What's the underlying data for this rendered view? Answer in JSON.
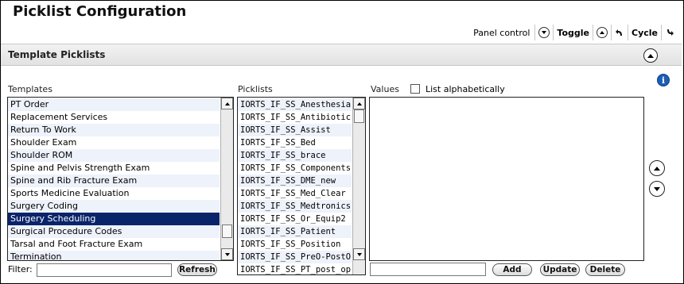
{
  "page": {
    "title": "Picklist Configuration"
  },
  "panel_control": {
    "label": "Panel control",
    "toggle_label": "Toggle",
    "cycle_label": "Cycle"
  },
  "section": {
    "title": "Template Picklists"
  },
  "templates": {
    "label": "Templates",
    "items": [
      "PT Order",
      "Replacement Services",
      "Return To Work",
      "Shoulder Exam",
      "Shoulder ROM",
      "Spine and Pelvis Strength Exam",
      "Spine and Rib Fracture Exam",
      "Sports Medicine Evaluation",
      "Surgery Coding",
      "Surgery Scheduling",
      "Surgical Procedure Codes",
      "Tarsal and Foot Fracture Exam",
      "Termination"
    ],
    "selected": "Surgery Scheduling"
  },
  "picklists": {
    "label": "Picklists",
    "items": [
      "IORTS_IF_SS_Anesthesia",
      "IORTS_IF_SS_Antibiotics",
      "IORTS_IF_SS_Assist",
      "IORTS_IF_SS_Bed",
      "IORTS_IF_SS_brace",
      "IORTS_IF_SS_Components",
      "IORTS_IF_SS_DME_new",
      "IORTS_IF_SS_Med_Clear",
      "IORTS_IF_SS_Medtronics",
      "IORTS_IF_SS_Or_Equip2",
      "IORTS_IF_SS_Patient",
      "IORTS_IF_SS_Position",
      "IORTS_IF_SS_PreO-PostO",
      "IORTS_IF_SS_PT_post_op"
    ]
  },
  "values": {
    "label": "Values",
    "list_alphabetically_label": "List alphabetically",
    "list_alphabetically_checked": false,
    "input_value": ""
  },
  "filter": {
    "label": "Filter:",
    "value": ""
  },
  "buttons": {
    "refresh": "Refresh",
    "add": "Add",
    "update": "Update",
    "delete": "Delete"
  },
  "icons": {
    "info": "info-icon",
    "info_glyph": "i",
    "collapse": "chevron-up-icon",
    "move_up": "arrow-up-icon",
    "move_down": "arrow-down-icon"
  },
  "colors": {
    "selected_row_bg": "#0a246a",
    "alt_row_bg": "#eef2fb",
    "info_blue": "#1d5fb5"
  }
}
